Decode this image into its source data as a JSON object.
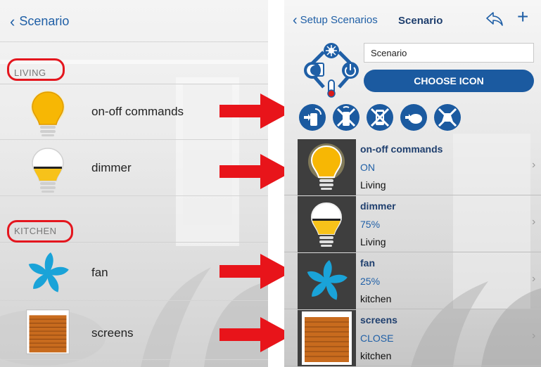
{
  "left": {
    "nav": {
      "back_label": "Scenario"
    },
    "sections": [
      {
        "label": "LIVING",
        "items": [
          {
            "label": "on-off commands",
            "icon": "lightbulb-on-icon"
          },
          {
            "label": "dimmer",
            "icon": "lightbulb-dim-icon"
          }
        ]
      },
      {
        "label": "KITCHEN",
        "items": [
          {
            "label": "fan",
            "icon": "fan-icon"
          },
          {
            "label": "screens",
            "icon": "roller-shutter-icon"
          }
        ]
      }
    ]
  },
  "right": {
    "nav": {
      "back_label": "Setup Scenarios",
      "title": "Scenario",
      "share_icon": "share-icon",
      "add_label": "+"
    },
    "scenario_icon": "scenario-cycle-icon",
    "name_input": {
      "value": "Scenario"
    },
    "choose_icon_label": "CHOOSE ICON",
    "toolbar_icons": [
      "remote-command-icon",
      "disabled-remote-icon",
      "disabled-phone-icon",
      "sensor-command-icon",
      "disabled-action-icon"
    ],
    "devices": [
      {
        "name": "on-off commands",
        "value": "ON",
        "room": "Living",
        "icon": "lightbulb-on-icon"
      },
      {
        "name": "dimmer",
        "value": "75%",
        "room": "Living",
        "icon": "lightbulb-dim-icon"
      },
      {
        "name": "fan",
        "value": "25%",
        "room": "kitchen",
        "icon": "fan-icon"
      },
      {
        "name": "screens",
        "value": "CLOSE",
        "room": "kitchen",
        "icon": "roller-shutter-icon"
      }
    ]
  },
  "colors": {
    "accent": "#1b5aa0",
    "title": "#1f3f6e",
    "highlight": "#e4161e",
    "bulb": "#f5b90a"
  }
}
